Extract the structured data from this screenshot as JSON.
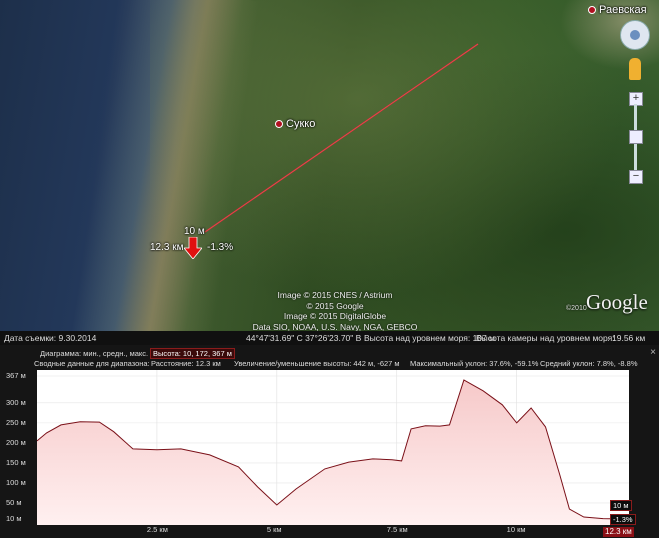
{
  "map": {
    "places": [
      {
        "label": "Раевская"
      },
      {
        "label": "Сукко"
      }
    ],
    "marker": {
      "elevation": "10 м",
      "distance": "12.3 км",
      "slope": "-1.3%"
    },
    "copyright": [
      "Image © 2015 CNES / Astrium",
      "© 2015 Google",
      "Image © 2015 DigitalGlobe",
      "Data SIO, NOAA, U.S. Navy, NGA, GEBCO"
    ],
    "logo": "Google",
    "logo_year": "©2010",
    "zoom": {
      "plus": "+",
      "minus": "−"
    }
  },
  "status_bar": {
    "date": "Дата съемки: 9.30.2014",
    "coords": "44°47'31.69\" С  37°26'23.70\" В",
    "elevation": "Высота над уровнем моря: 107 м",
    "eye_alt": "Высота камеры над уровнем моря:",
    "eye_alt_value": "19.56 км"
  },
  "elevation_profile": {
    "close": "×",
    "row1_label": "Диаграмма: мин., средн., макс.",
    "row1_value": "Высота: 10, 172, 367 м",
    "row2_label": "Сводные данные для диапазона:",
    "distance": "Расстояние: 12.3 км",
    "gain": "Увеличение/уменьшение высоты: 442 м, -627 м",
    "max_slope": "Максимальный уклон: 37.6%, -59.1%",
    "avg_slope": "Средний уклон: 7.8%, -8.8%",
    "end_elevation": "10 м",
    "end_slope": "-1.3%",
    "end_distance": "12.3 км"
  },
  "chart_data": {
    "type": "area",
    "x_unit": "км",
    "y_unit": "м",
    "xlim": [
      0,
      12.3
    ],
    "ylim": [
      0,
      367
    ],
    "y_ticks": [
      "10 м",
      "50 м",
      "100 м",
      "150 м",
      "200 м",
      "250 м",
      "300 м",
      "367 м"
    ],
    "y_tick_values": [
      10,
      50,
      100,
      150,
      200,
      250,
      300,
      367
    ],
    "x_ticks": [
      "2.5 км",
      "5 км",
      "7.5 км",
      "10 км"
    ],
    "x_tick_values": [
      2.5,
      5,
      7.5,
      10
    ],
    "fill_color": "#f6c9c9",
    "line_color": "#7a1018",
    "x": [
      0,
      0.2,
      0.5,
      0.9,
      1.3,
      1.6,
      2.0,
      2.5,
      3.0,
      3.6,
      4.2,
      4.6,
      5.0,
      5.4,
      6.0,
      6.5,
      7.0,
      7.4,
      7.6,
      7.8,
      8.1,
      8.4,
      8.6,
      8.9,
      9.3,
      9.7,
      10.0,
      10.3,
      10.6,
      10.9,
      11.1,
      11.4,
      11.8,
      12.3
    ],
    "y": [
      205,
      225,
      245,
      253,
      252,
      228,
      185,
      183,
      185,
      170,
      140,
      90,
      45,
      85,
      135,
      152,
      160,
      158,
      155,
      235,
      243,
      242,
      245,
      357,
      330,
      295,
      250,
      287,
      240,
      120,
      35,
      15,
      11,
      10
    ]
  }
}
